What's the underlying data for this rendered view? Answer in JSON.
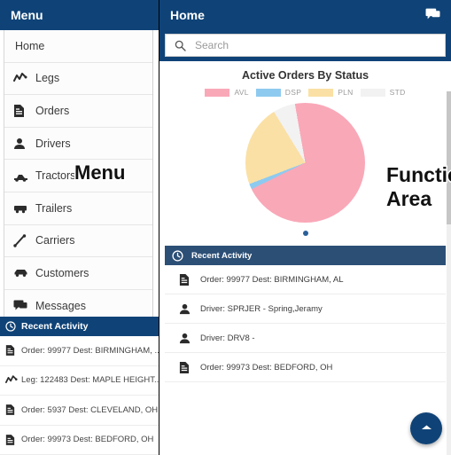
{
  "left": {
    "header_title": "Menu",
    "menu_items": [
      {
        "label": "Home",
        "icon": "none"
      },
      {
        "label": "Legs",
        "icon": "chart-line-icon"
      },
      {
        "label": "Orders",
        "icon": "document-icon"
      },
      {
        "label": "Drivers",
        "icon": "person-icon"
      },
      {
        "label": "Tractors",
        "icon": "tractor-icon"
      },
      {
        "label": "Trailers",
        "icon": "trailer-icon"
      },
      {
        "label": "Carriers",
        "icon": "route-icon"
      },
      {
        "label": "Customers",
        "icon": "car-icon"
      },
      {
        "label": "Messages",
        "icon": "chat-icon"
      }
    ],
    "recent_activity": {
      "title": "Recent Activity",
      "icon": "clock-icon",
      "items": [
        {
          "text": "Order: 99977 Dest: BIRMINGHAM, ...",
          "icon": "document-icon"
        },
        {
          "text": "Leg: 122483 Dest: MAPLE HEIGHT...",
          "icon": "chart-line-icon"
        },
        {
          "text": "Order: 5937 Dest: CLEVELAND, OH",
          "icon": "document-icon"
        },
        {
          "text": "Order: 99973 Dest: BEDFORD, OH",
          "icon": "document-icon"
        }
      ]
    }
  },
  "right": {
    "header_title": "Home",
    "header_icon": "chat-icon",
    "search": {
      "value": "",
      "placeholder": "Search",
      "icon": "search-icon"
    },
    "recent_activity": {
      "title": "Recent Activity",
      "icon": "clock-icon",
      "items": [
        {
          "text": "Order: 99977 Dest: BIRMINGHAM, AL",
          "icon": "document-icon"
        },
        {
          "text": "Driver: SPRJER - Spring,Jeramy",
          "icon": "person-icon"
        },
        {
          "text": "Driver: DRV8 -",
          "icon": "person-icon"
        },
        {
          "text": "Order: 99973 Dest: BEDFORD, OH",
          "icon": "document-icon"
        }
      ]
    },
    "fab": {
      "icon": "arrow-up-icon"
    },
    "carousel": {
      "active_dot": 1,
      "total_dots": 1
    }
  },
  "annotations": [
    {
      "text": "Menu"
    },
    {
      "text": "Functional Area"
    }
  ],
  "chart_data": {
    "type": "pie",
    "title": "Active Orders By Status",
    "legend_position": "top",
    "categories": [
      "AVL",
      "DSP",
      "PLN",
      "STD"
    ],
    "values": [
      70.5,
      1.5,
      22,
      6
    ],
    "colors": [
      "#f9a8b8",
      "#8ecaf0",
      "#fae0a4",
      "#f2f2f2"
    ],
    "labels": [
      "AVL",
      "DSP",
      "PLN",
      "STD"
    ],
    "xlabel": "",
    "ylabel": ""
  },
  "theme": {
    "header_blue": "#0f4377",
    "subheader_blue": "#2c4f76",
    "dot_blue": "#2a6099",
    "accent_pink": "#f9a8b8",
    "accent_blue": "#8ecaf0",
    "accent_yellow": "#fae0a4",
    "accent_gray": "#f2f2f2"
  }
}
